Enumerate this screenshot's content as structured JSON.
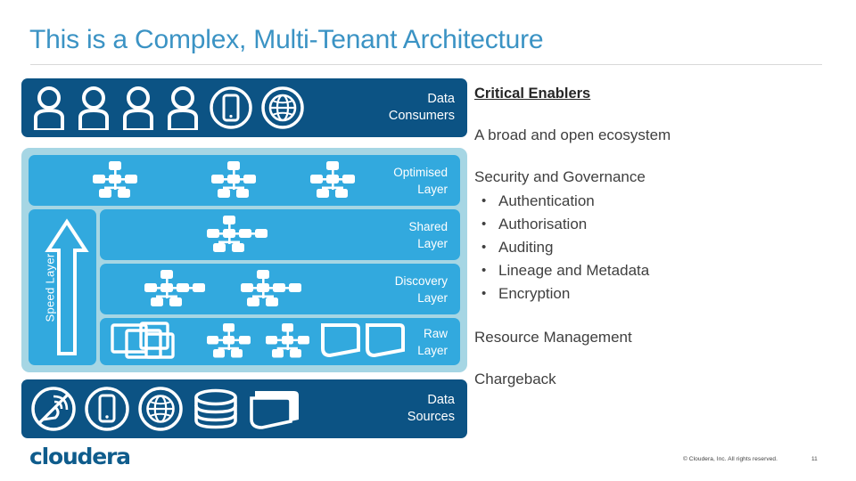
{
  "slide": {
    "title": "This is a Complex, Multi-Tenant Architecture",
    "page_number": "11",
    "copyright": "© Cloudera, Inc. All rights reserved.",
    "logo_text": "cloudera"
  },
  "colors": {
    "title_blue": "#3b93c4",
    "dark_band": "#0c5384",
    "layer_blue": "#32a9de",
    "container_teal": "#a6d6e4",
    "body_text": "#3f3f3f",
    "icon_white": "#ffffff"
  },
  "diagram": {
    "consumers_band": {
      "label": "Data\nConsumers",
      "icons": [
        "person-icon",
        "person-icon",
        "person-icon",
        "person-icon",
        "mobile-phone-circle-icon",
        "globe-circle-icon"
      ]
    },
    "speed_layer": {
      "label": "Speed Layer",
      "arrow": "up-arrow-icon"
    },
    "layers": [
      {
        "key": "optimised",
        "label": "Optimised\nLayer",
        "icons": [
          "network-node-icon",
          "network-node-icon",
          "network-node-icon"
        ]
      },
      {
        "key": "shared",
        "label": "Shared\nLayer",
        "icons": [
          "network-node-wide-icon"
        ]
      },
      {
        "key": "discovery",
        "label": "Discovery\nLayer",
        "icons": [
          "network-node-wide-icon",
          "network-node-wide-icon"
        ]
      },
      {
        "key": "raw",
        "label": "Raw\nLayer",
        "icons": [
          "stacked-windows-icon",
          "network-node-icon",
          "network-node-icon",
          "document-pair-icon"
        ]
      }
    ],
    "sources_band": {
      "label": "Data\nSources",
      "icons": [
        "satellite-dish-circle-icon",
        "mobile-phone-circle-icon",
        "globe-circle-icon",
        "database-icon",
        "folder-icon"
      ]
    }
  },
  "enablers": {
    "heading": "Critical Enablers",
    "ecosystem": "A broad and open ecosystem",
    "security_heading": "Security and Governance",
    "security_items": [
      "Authentication",
      "Authorisation",
      "Auditing",
      "Lineage and Metadata",
      "Encryption"
    ],
    "resource_management": "Resource Management",
    "chargeback": "Chargeback"
  }
}
